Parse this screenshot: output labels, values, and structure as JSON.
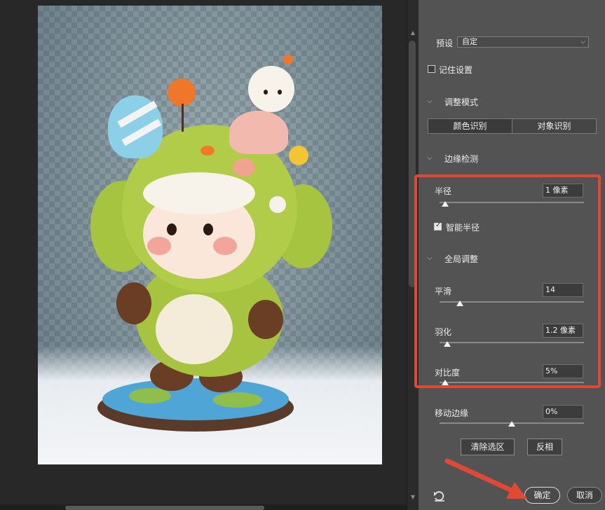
{
  "panel": {
    "preset": {
      "label": "预设",
      "value": "自定"
    },
    "remember_settings": {
      "label": "记住设置",
      "checked": false
    },
    "adjust_mode": {
      "title": "调整模式",
      "options": [
        "颜色识别",
        "对象识别"
      ],
      "selected": "颜色识别"
    },
    "edge_detection": {
      "title": "边缘检测",
      "radius": {
        "label": "半径",
        "value": "1 像素",
        "level": 0.02
      },
      "smart_radius": {
        "label": "智能半径",
        "checked": true
      }
    },
    "global_adjust": {
      "title": "全局调整",
      "smooth": {
        "label": "平滑",
        "value": "14",
        "level": 0.14
      },
      "feather": {
        "label": "羽化",
        "value": "1.2 像素",
        "level": 0.03
      },
      "contrast": {
        "label": "对比度",
        "value": "5%",
        "level": 0.05
      },
      "shift_edge": {
        "label": "移动边缘",
        "value": "0%",
        "level": 0.5
      }
    },
    "buttons": {
      "clear_selection": "清除选区",
      "invert": "反相",
      "ok": "确定",
      "cancel": "取消"
    }
  },
  "colors": {
    "panel_bg": "#535353",
    "annotation": "#e04a35",
    "canvas_bg": "#282828"
  },
  "icons": {
    "reset": "reset-icon",
    "chevron": "chevron-down-icon"
  }
}
